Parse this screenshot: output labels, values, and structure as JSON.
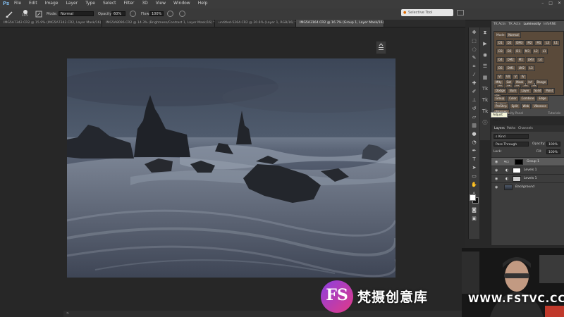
{
  "app": {
    "logo": "Ps"
  },
  "menubar": {
    "items": [
      "File",
      "Edit",
      "Image",
      "Layer",
      "Type",
      "Select",
      "Filter",
      "3D",
      "View",
      "Window",
      "Help"
    ]
  },
  "options": {
    "brush_size": "105",
    "mode_label": "Mode:",
    "mode_value": "Normal",
    "opacity_label": "Opacity:",
    "opacity_value": "60%",
    "flow_label": "Flow:",
    "flow_value": "100%"
  },
  "search": {
    "placeholder": "Selective Tool"
  },
  "doc_tabs": [
    "IMG5A7342.CR2 @ 15.9% (IMG5A7342.CR2, Layer Mask/16) *",
    "IMG5A8096.CR2 @ 14.3% (Brightness/Contrast 1, Layer Mask/16) *",
    "untitled-5264.CR2 @ 20.6% (Layer 1, RGB/16) *",
    "IMG5A3164.CR2 @ 16.7% (Group 1, Layer Mask/16) *"
  ],
  "tk_panel": {
    "tabs": [
      "TK Actn",
      "TK Actn",
      "Luminosity",
      "InfoRNE"
    ],
    "mode_label": "Mode:",
    "mode_value": "Normal",
    "rows": [
      [
        "D1",
        "D2",
        "DM3",
        "M2",
        "M1",
        "L3",
        "L1"
      ],
      [
        "D3",
        "D2",
        "D1",
        "M3",
        "L2",
        "L1"
      ],
      [
        "D4",
        "DM2",
        "M1",
        "LM3",
        "L4"
      ],
      [
        "D5",
        "DM1",
        "LM2",
        "L3"
      ],
      [
        "VI",
        "VII",
        "V",
        "IV"
      ],
      [
        "S1",
        "S2",
        "S3",
        "S4",
        "S5"
      ]
    ],
    "bottom_rows": [
      [
        "Mlty",
        "Sat",
        "Mask",
        "Inf",
        "Range"
      ],
      [
        "Dodge",
        "Burn",
        "Layer",
        "Solid",
        "Paint",
        "Fill"
      ],
      [
        "Group",
        "Color",
        "Combine",
        "Edge",
        "Restore"
      ],
      [
        "PreShrp",
        "Split",
        "Web",
        "Vibrance",
        "Sharpen"
      ]
    ],
    "footer": "TK Luminosity Panel",
    "tabs_label": "Tutorials"
  },
  "tooltip": "Adjust Pro 2",
  "layers_panel": {
    "tabs": [
      "Layers",
      "Paths",
      "Channels"
    ],
    "kind_label": "Kind",
    "blend": "Pass Through",
    "opacity_label": "Opacity:",
    "opacity_value": "100%",
    "lock_label": "Lock:",
    "fill_label": "Fill:",
    "fill_value": "100%",
    "layers": [
      {
        "name": "Group 1",
        "selected": true
      },
      {
        "name": "Levels 1",
        "selected": false
      },
      {
        "name": "Levels 1",
        "selected": false
      },
      {
        "name": "Background",
        "selected": false
      }
    ]
  },
  "status": {
    "text": ">"
  },
  "watermark": {
    "logo_text": "FS",
    "brand": "梵摄创意库",
    "url": "WWW.FSTVC.CC"
  },
  "colors": {
    "accent": "#e23a86",
    "brand_purple": "#8b3fe0",
    "ps_blue": "#7fb8e8"
  }
}
